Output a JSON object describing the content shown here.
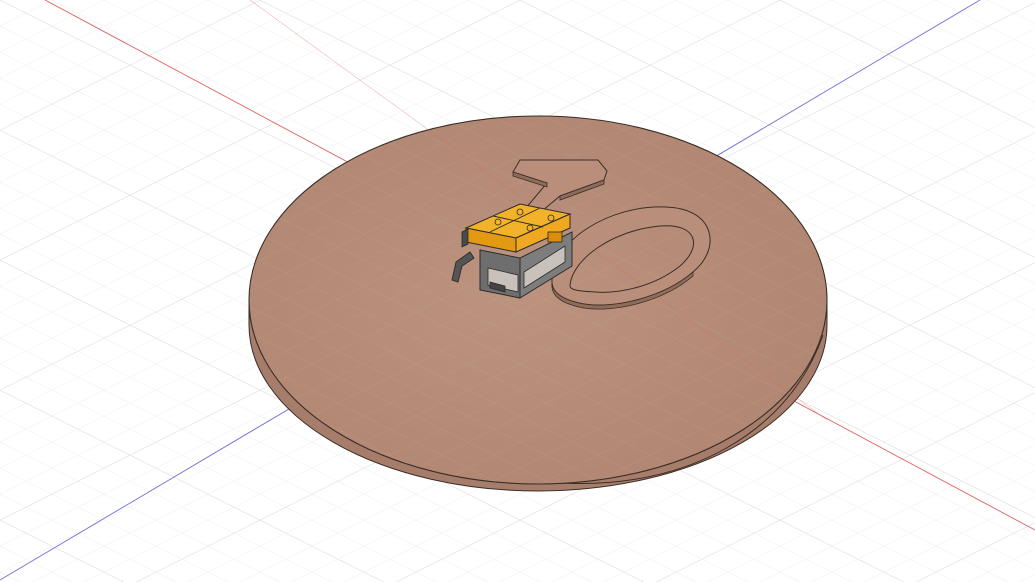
{
  "viewport": {
    "view": "3d-model-viewport",
    "projection": "isometric",
    "grid": true,
    "axis_colors": {
      "x": "#e06060",
      "y": "#6f6fd8"
    }
  },
  "model": {
    "base_disc": {
      "top_color": "#b88f7d",
      "side_color": "#a67d6a"
    },
    "engraved_digits": [
      "1",
      "0"
    ],
    "component": {
      "body_color": "#f0a820",
      "frame_color": "#5a5a5a"
    }
  }
}
